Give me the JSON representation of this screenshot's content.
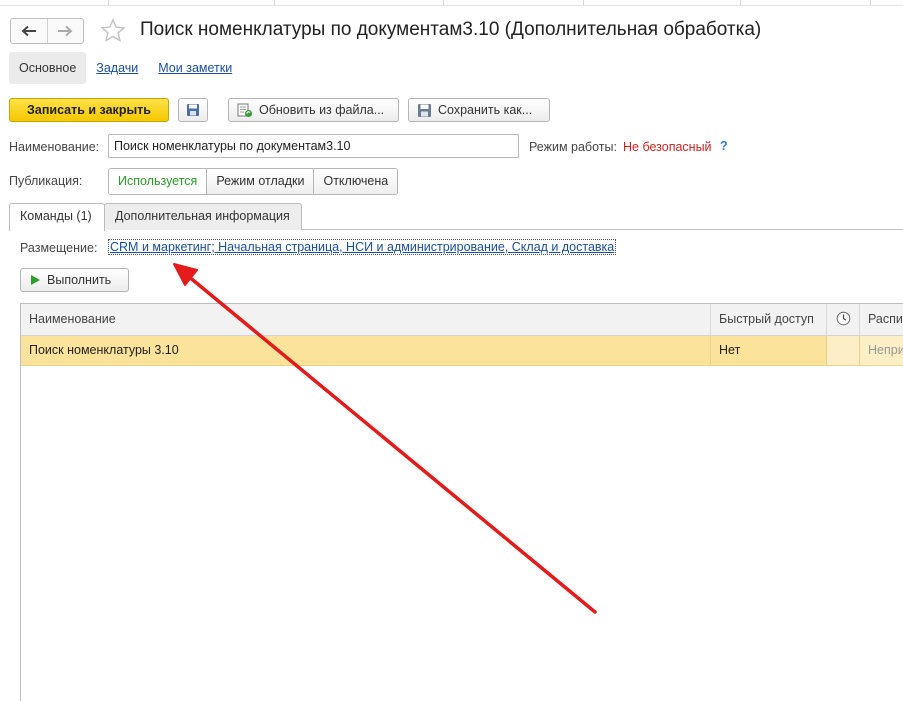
{
  "window": {
    "title": "Поиск номенклатуры по документам3.10 (Дополнительная обработка)"
  },
  "nav": {
    "back_icon": "arrow-left-icon",
    "forward_icon": "arrow-right-icon",
    "favorite_icon": "star-icon"
  },
  "sections": {
    "main": "Основное",
    "tasks": "Задачи",
    "notes": "Мои заметки"
  },
  "toolbar": {
    "save_close": "Записать и закрыть",
    "refresh": "Обновить из файла...",
    "save_as": "Сохранить как..."
  },
  "form": {
    "name_label": "Наименование:",
    "name_value": "Поиск номенклатуры по документам3.10",
    "mode_label": "Режим работы:",
    "mode_value": "Не безопасный",
    "mode_help": "?",
    "publication_label": "Публикация:",
    "publication_options": [
      "Используется",
      "Режим отладки",
      "Отключена"
    ],
    "publication_selected": "Используется"
  },
  "tabs": {
    "commands": "Команды (1)",
    "extra": "Дополнительная информация"
  },
  "placement": {
    "label": "Размещение:",
    "value": "CRM и маркетинг; Начальная страница, НСИ и администрирование, Склад и доставка"
  },
  "execute_label": "Выполнить",
  "table": {
    "headers": {
      "name": "Наименование",
      "quick": "Быстрый доступ",
      "schedule_icon": "clock-icon",
      "schedule": "Распи"
    },
    "rows": [
      {
        "name": "Поиск номенклатуры 3.10",
        "quick": "Нет",
        "schedule": "Непри"
      }
    ]
  },
  "colors": {
    "primary_button": "#f4c800",
    "selected_row": "#fbe39b",
    "warning_text": "#d32020",
    "link": "#1a4fa0",
    "annotation_arrow": "#e31b1b"
  }
}
